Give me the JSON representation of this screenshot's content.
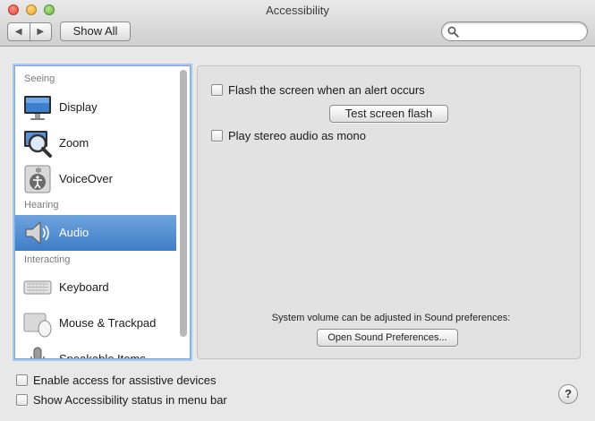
{
  "window": {
    "title": "Accessibility"
  },
  "toolbar": {
    "back_glyph": "◀",
    "forward_glyph": "▶",
    "show_all_label": "Show All",
    "search": {
      "value": "",
      "placeholder": ""
    }
  },
  "sidebar": {
    "sections": [
      {
        "header": "Seeing"
      },
      {
        "header": "Hearing"
      },
      {
        "header": "Interacting"
      }
    ],
    "items": [
      {
        "label": "Display",
        "icon": "display-icon",
        "selected": false
      },
      {
        "label": "Zoom",
        "icon": "zoom-icon",
        "selected": false
      },
      {
        "label": "VoiceOver",
        "icon": "voiceover-icon",
        "selected": false
      },
      {
        "label": "Audio",
        "icon": "speaker-icon",
        "selected": true
      },
      {
        "label": "Keyboard",
        "icon": "keyboard-icon",
        "selected": false
      },
      {
        "label": "Mouse & Trackpad",
        "icon": "mouse-trackpad-icon",
        "selected": false
      },
      {
        "label": "Speakable Items",
        "icon": "speakable-items-icon",
        "selected": false
      }
    ]
  },
  "pane": {
    "flash_checkbox_label": "Flash the screen when an alert occurs",
    "flash_checked": false,
    "test_flash_button": "Test screen flash",
    "mono_checkbox_label": "Play stereo audio as mono",
    "mono_checked": false,
    "sound_note": "System volume can be adjusted in Sound preferences:",
    "open_sound_button": "Open Sound Preferences..."
  },
  "footer": {
    "assistive_label": "Enable access for assistive devices",
    "assistive_checked": false,
    "status_label": "Show Accessibility status in menu bar",
    "status_checked": false,
    "help_glyph": "?"
  },
  "colors": {
    "selection": "#3e7ec8",
    "focus_ring": "#a9c6ec"
  }
}
